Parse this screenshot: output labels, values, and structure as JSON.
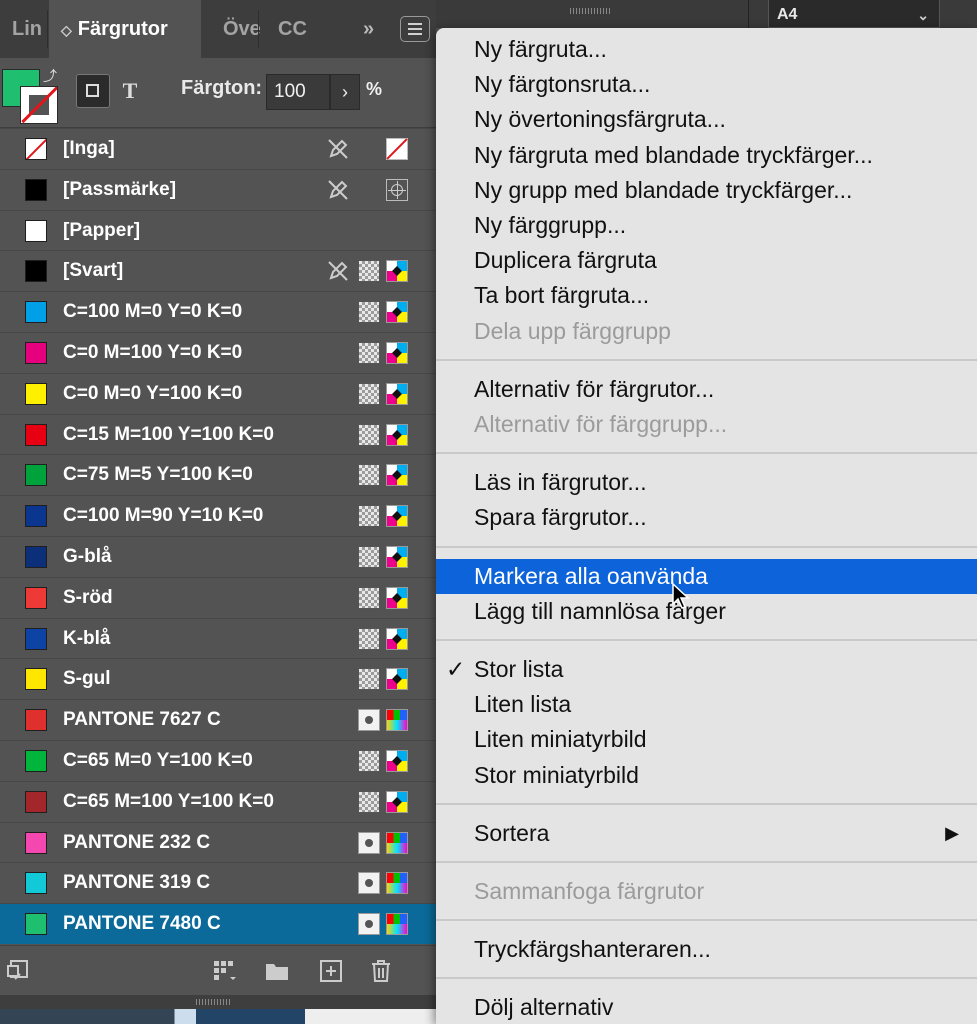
{
  "panel": {
    "tabs": [
      {
        "label": "Lin",
        "active": false
      },
      {
        "label": "Färgrutor",
        "active": true
      },
      {
        "label": "Öve",
        "active": false
      },
      {
        "label": "CC",
        "active": false
      }
    ],
    "tabs_overflow_label": "»",
    "active_tab_chevron": "◇",
    "fill_color": "#1ebf6e",
    "tint_label": "Färgton:",
    "tint_value": "100",
    "tint_unit": "%",
    "tint_arrow": "›",
    "text_tool_label": "T",
    "swatches": [
      {
        "name": "[Inga]",
        "color": "none",
        "edit_locked": true,
        "type_icon": "",
        "mode_icon": "none-icon"
      },
      {
        "name": "[Passmärke]",
        "color": "#000000",
        "edit_locked": true,
        "type_icon": "",
        "mode_icon": "registration-icon"
      },
      {
        "name": "[Papper]",
        "color": "#ffffff",
        "edit_locked": false,
        "type_icon": "",
        "mode_icon": ""
      },
      {
        "name": "[Svart]",
        "color": "#000000",
        "edit_locked": true,
        "type_icon": "process-icon",
        "mode_icon": "cmyk-icon"
      },
      {
        "name": "C=100 M=0 Y=0 K=0",
        "color": "#00a0e9",
        "edit_locked": false,
        "type_icon": "process-icon",
        "mode_icon": "cmyk-icon"
      },
      {
        "name": "C=0 M=100 Y=0 K=0",
        "color": "#e6007e",
        "edit_locked": false,
        "type_icon": "process-icon",
        "mode_icon": "cmyk-icon"
      },
      {
        "name": "C=0 M=0 Y=100 K=0",
        "color": "#fff000",
        "edit_locked": false,
        "type_icon": "process-icon",
        "mode_icon": "cmyk-icon"
      },
      {
        "name": "C=15 M=100 Y=100 K=0",
        "color": "#e60012",
        "edit_locked": false,
        "type_icon": "process-icon",
        "mode_icon": "cmyk-icon"
      },
      {
        "name": "C=75 M=5 Y=100 K=0",
        "color": "#00a23b",
        "edit_locked": false,
        "type_icon": "process-icon",
        "mode_icon": "cmyk-icon"
      },
      {
        "name": "C=100 M=90 Y=10 K=0",
        "color": "#0b3690",
        "edit_locked": false,
        "type_icon": "process-icon",
        "mode_icon": "cmyk-icon"
      },
      {
        "name": "G-blå",
        "color": "#0c2f7a",
        "edit_locked": false,
        "type_icon": "process-icon",
        "mode_icon": "cmyk-icon"
      },
      {
        "name": "S-röd",
        "color": "#ee3a36",
        "edit_locked": false,
        "type_icon": "process-icon",
        "mode_icon": "cmyk-icon"
      },
      {
        "name": "K-blå",
        "color": "#0e43a6",
        "edit_locked": false,
        "type_icon": "process-icon",
        "mode_icon": "cmyk-icon"
      },
      {
        "name": "S-gul",
        "color": "#ffe600",
        "edit_locked": false,
        "type_icon": "process-icon",
        "mode_icon": "cmyk-icon"
      },
      {
        "name": "PANTONE 7627 C",
        "color": "#e0302d",
        "edit_locked": false,
        "type_icon": "spot-icon",
        "mode_icon": "rgb-icon"
      },
      {
        "name": "C=65 M=0 Y=100 K=0",
        "color": "#00b43c",
        "edit_locked": false,
        "type_icon": "process-icon",
        "mode_icon": "cmyk-icon"
      },
      {
        "name": "C=65 M=100 Y=100 K=0",
        "color": "#a3262a",
        "edit_locked": false,
        "type_icon": "process-icon",
        "mode_icon": "cmyk-icon"
      },
      {
        "name": "PANTONE 232 C",
        "color": "#f447b0",
        "edit_locked": false,
        "type_icon": "spot-icon",
        "mode_icon": "rgb-icon"
      },
      {
        "name": "PANTONE 319 C",
        "color": "#12c9d8",
        "edit_locked": false,
        "type_icon": "spot-icon",
        "mode_icon": "rgb-icon"
      },
      {
        "name": "PANTONE 7480 C",
        "color": "#1ebf6e",
        "edit_locked": false,
        "type_icon": "spot-icon",
        "mode_icon": "rgb-icon",
        "selected": true
      }
    ],
    "footer_icons": [
      "swatch-view-icon",
      "show-kinds-icon",
      "new-group-folder-icon",
      "new-swatch-icon",
      "delete-swatch-icon"
    ]
  },
  "chrome": {
    "page_size": "A4",
    "page_size_chevron": "⌄"
  },
  "menu": {
    "items": [
      {
        "label": "Ny färgruta...",
        "disabled": false
      },
      {
        "label": "Ny färgtonsruta...",
        "disabled": false
      },
      {
        "label": "Ny övertoningsfärgruta...",
        "disabled": false
      },
      {
        "label": "Ny färgruta med blandade tryckfärger...",
        "disabled": false
      },
      {
        "label": "Ny grupp med blandade tryckfärger...",
        "disabled": false
      },
      {
        "label": "Ny färggrupp...",
        "disabled": false
      },
      {
        "label": "Duplicera färgruta",
        "disabled": false
      },
      {
        "label": "Ta bort färgruta...",
        "disabled": false
      },
      {
        "label": "Dela upp färggrupp",
        "disabled": true
      },
      {
        "separator": true
      },
      {
        "label": "Alternativ för färgrutor...",
        "disabled": false
      },
      {
        "label": "Alternativ för färggrupp...",
        "disabled": true
      },
      {
        "separator": true
      },
      {
        "label": "Läs in färgrutor...",
        "disabled": false
      },
      {
        "label": "Spara färgrutor...",
        "disabled": false
      },
      {
        "separator": true
      },
      {
        "label": "Markera alla oanvända",
        "disabled": false,
        "highlighted": true
      },
      {
        "label": "Lägg till namnlösa färger",
        "disabled": false
      },
      {
        "separator": true
      },
      {
        "label": "Stor lista",
        "disabled": false,
        "checked": true
      },
      {
        "label": "Liten lista",
        "disabled": false
      },
      {
        "label": "Liten miniatyrbild",
        "disabled": false
      },
      {
        "label": "Stor miniatyrbild",
        "disabled": false
      },
      {
        "separator": true
      },
      {
        "label": "Sortera",
        "disabled": false,
        "submenu": true
      },
      {
        "separator": true
      },
      {
        "label": "Sammanfoga färgrutor",
        "disabled": true
      },
      {
        "separator": true
      },
      {
        "label": "Tryckfärgshanteraren...",
        "disabled": false
      },
      {
        "separator": true
      },
      {
        "label": "Dölj alternativ",
        "disabled": false
      }
    ],
    "check_glyph": "✓",
    "submenu_glyph": "▶",
    "accent_color": "#0d63d9"
  }
}
